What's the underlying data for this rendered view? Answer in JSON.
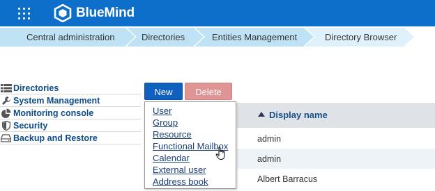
{
  "app": {
    "name": "BlueMind"
  },
  "breadcrumb": [
    "Central administration",
    "Directories",
    "Entities Management",
    "Directory Browser"
  ],
  "nav": [
    {
      "label": "Directories",
      "icon": "list-icon"
    },
    {
      "label": "System Management",
      "icon": "wrench-icon"
    },
    {
      "label": "Monitoring console",
      "icon": "pie-chart-icon"
    },
    {
      "label": "Security",
      "icon": "shield-icon"
    },
    {
      "label": "Backup and Restore",
      "icon": "drive-icon"
    }
  ],
  "toolbar": {
    "new_label": "New",
    "delete_label": "Delete"
  },
  "menu": [
    "User",
    "Group",
    "Resource",
    "Functional Mailbox",
    "Calendar",
    "External user",
    "Address book"
  ],
  "grid": {
    "column": "Display name",
    "sort": "ascending",
    "rows": [
      "admin",
      "admin",
      "Albert Barracus"
    ]
  },
  "colors": {
    "topbar": "#0d6fc9",
    "breadcrumb": "#bfe3f5",
    "primary_button": "#1060c0",
    "delete_button": "#e09494"
  }
}
